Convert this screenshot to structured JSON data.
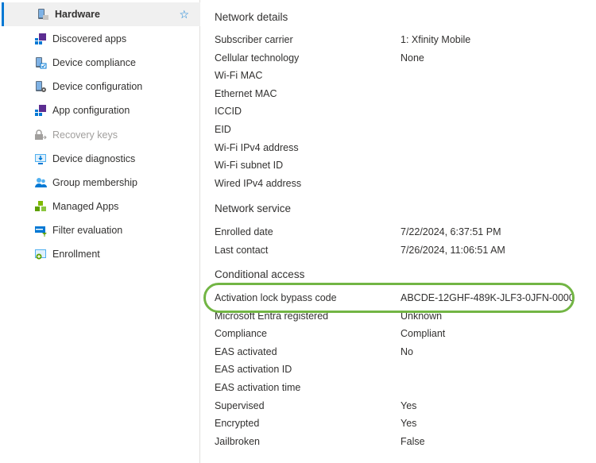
{
  "sidebar": {
    "items": [
      {
        "label": "Hardware",
        "icon": "hardware-icon"
      },
      {
        "label": "Discovered apps",
        "icon": "discovered-apps-icon"
      },
      {
        "label": "Device compliance",
        "icon": "device-compliance-icon"
      },
      {
        "label": "Device configuration",
        "icon": "device-configuration-icon"
      },
      {
        "label": "App configuration",
        "icon": "app-configuration-icon"
      },
      {
        "label": "Recovery keys",
        "icon": "recovery-keys-icon"
      },
      {
        "label": "Device diagnostics",
        "icon": "device-diagnostics-icon"
      },
      {
        "label": "Group membership",
        "icon": "group-membership-icon"
      },
      {
        "label": "Managed Apps",
        "icon": "managed-apps-icon"
      },
      {
        "label": "Filter evaluation",
        "icon": "filter-evaluation-icon"
      },
      {
        "label": "Enrollment",
        "icon": "enrollment-icon"
      }
    ]
  },
  "network_details": {
    "title": "Network details",
    "rows": [
      {
        "label": "Subscriber carrier",
        "value": "1: Xfinity Mobile"
      },
      {
        "label": "Cellular technology",
        "value": "None"
      },
      {
        "label": "Wi-Fi MAC",
        "value": ""
      },
      {
        "label": "Ethernet MAC",
        "value": ""
      },
      {
        "label": "ICCID",
        "value": ""
      },
      {
        "label": "EID",
        "value": ""
      },
      {
        "label": "Wi-Fi IPv4 address",
        "value": ""
      },
      {
        "label": "Wi-Fi subnet ID",
        "value": ""
      },
      {
        "label": "Wired IPv4 address",
        "value": ""
      }
    ]
  },
  "network_service": {
    "title": "Network service",
    "rows": [
      {
        "label": "Enrolled date",
        "value": "7/22/2024, 6:37:51 PM"
      },
      {
        "label": "Last contact",
        "value": "7/26/2024, 11:06:51 AM"
      }
    ]
  },
  "conditional_access": {
    "title": "Conditional access",
    "rows": [
      {
        "label": "Activation lock bypass code",
        "value": "ABCDE-12GHF-489K-JLF3-0JFN-0000"
      },
      {
        "label": "Microsoft Entra registered",
        "value": "Unknown"
      },
      {
        "label": "Compliance",
        "value": "Compliant"
      },
      {
        "label": "EAS activated",
        "value": "No"
      },
      {
        "label": "EAS activation ID",
        "value": ""
      },
      {
        "label": "EAS activation time",
        "value": ""
      },
      {
        "label": "Supervised",
        "value": "Yes"
      },
      {
        "label": "Encrypted",
        "value": "Yes"
      },
      {
        "label": "Jailbroken",
        "value": "False"
      }
    ]
  },
  "colors": {
    "accent": "#0078d4",
    "highlight": "#72b544"
  }
}
